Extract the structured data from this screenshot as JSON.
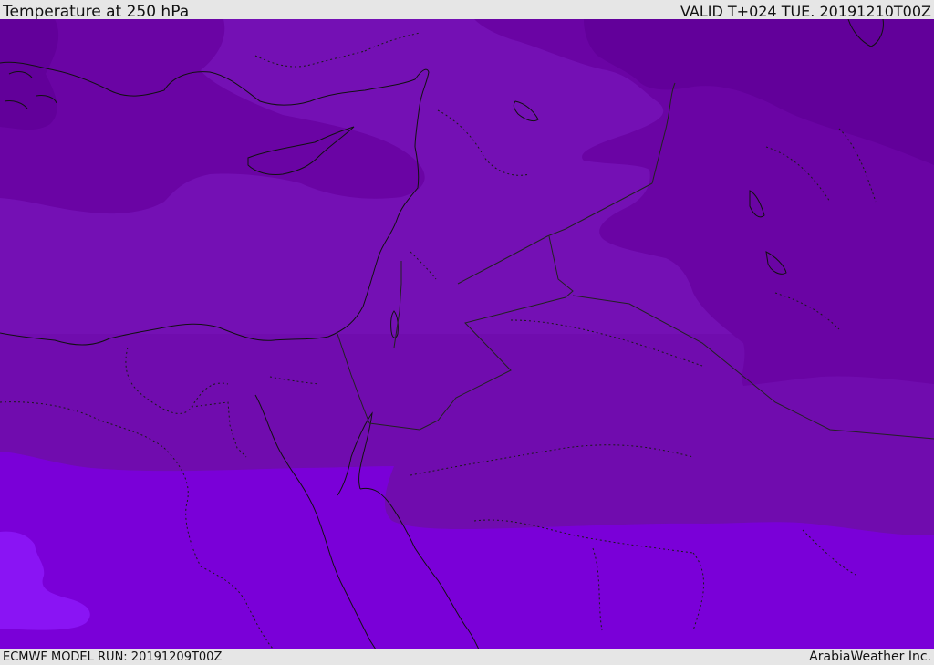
{
  "header": {
    "title": "Temperature at 250 hPa",
    "valid_time": "VALID T+024 TUE. 20191210T00Z"
  },
  "footer": {
    "model_run": "ECMWF MODEL RUN: 20191209T00Z",
    "credit": "ArabiaWeather Inc."
  },
  "map": {
    "field": "temperature-250hPa",
    "colors": {
      "band_coldest": "#62009a",
      "band_cold": "#6a04a4",
      "band_mid": "#7410b4",
      "band_warm": "#7a00d8",
      "band_warmest": "#8a14f4",
      "coastline": "#111111",
      "borders": "#222222"
    }
  }
}
